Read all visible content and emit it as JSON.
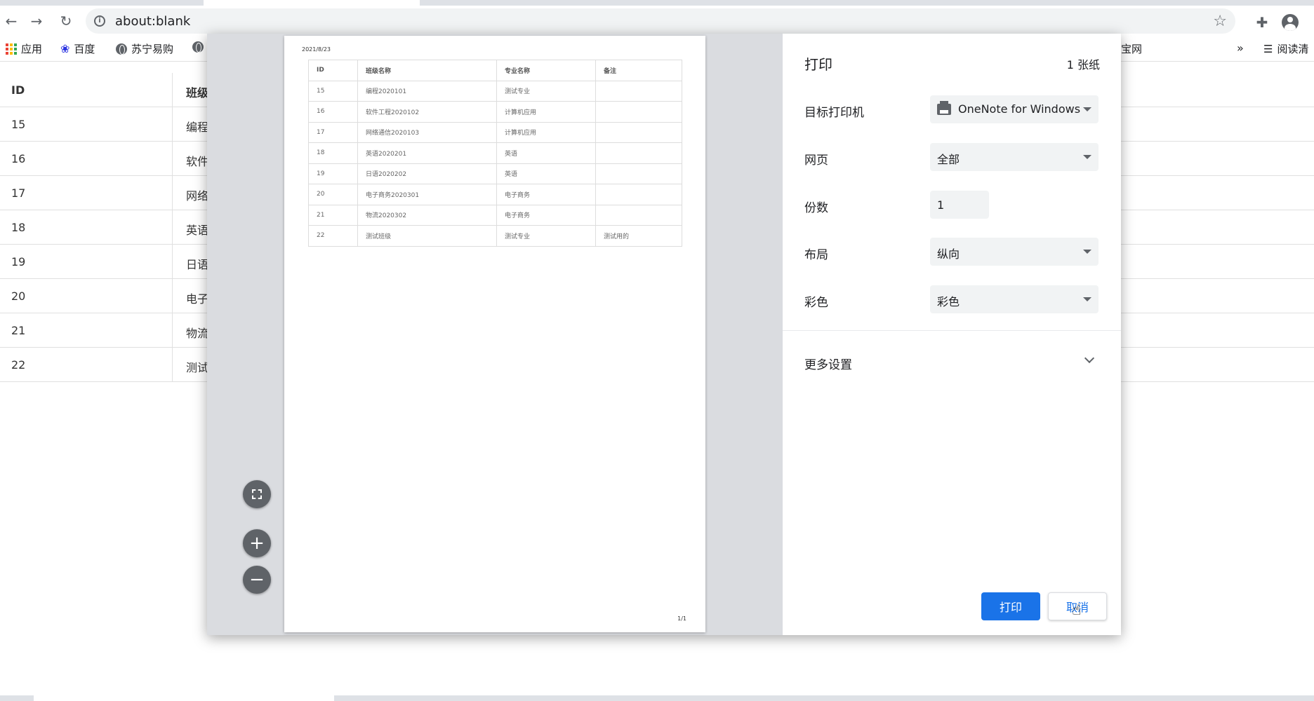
{
  "browser": {
    "url": "about:blank",
    "bookmarks": [
      "应用",
      "百度",
      "苏宁易购",
      "宝网",
      "阅读清"
    ],
    "overflow_chevron": "»"
  },
  "background_table": {
    "headers": [
      "ID",
      "班级"
    ],
    "rows": [
      [
        "15",
        "编程"
      ],
      [
        "16",
        "软件"
      ],
      [
        "17",
        "网络"
      ],
      [
        "18",
        "英语"
      ],
      [
        "19",
        "日语"
      ],
      [
        "20",
        "电子"
      ],
      [
        "21",
        "物流"
      ],
      [
        "22",
        "测试"
      ]
    ]
  },
  "print_preview": {
    "date": "2021/8/23",
    "page_number": "1/1",
    "headers": [
      "ID",
      "班级名称",
      "专业名称",
      "备注"
    ],
    "rows": [
      [
        "15",
        "编程2020101",
        "测试专业",
        ""
      ],
      [
        "16",
        "软件工程2020102",
        "计算机应用",
        ""
      ],
      [
        "17",
        "网络通信2020103",
        "计算机应用",
        ""
      ],
      [
        "18",
        "英语2020201",
        "英语",
        ""
      ],
      [
        "19",
        "日语2020202",
        "英语",
        ""
      ],
      [
        "20",
        "电子商务2020301",
        "电子商务",
        ""
      ],
      [
        "21",
        "物流2020302",
        "电子商务",
        ""
      ],
      [
        "22",
        "测试班级",
        "测试专业",
        "测试用的"
      ]
    ]
  },
  "print_settings": {
    "title": "打印",
    "sheets": "1 张纸",
    "destination_label": "目标打印机",
    "destination_value": "OneNote for Windows",
    "pages_label": "网页",
    "pages_value": "全部",
    "copies_label": "份数",
    "copies_value": "1",
    "layout_label": "布局",
    "layout_value": "纵向",
    "color_label": "彩色",
    "color_value": "彩色",
    "more_settings": "更多设置",
    "print_button": "打印",
    "cancel_button": "取消"
  },
  "colors": {
    "accent": "#1a73e8",
    "preview_bg": "#dadce0",
    "fab": "#5f6368"
  }
}
